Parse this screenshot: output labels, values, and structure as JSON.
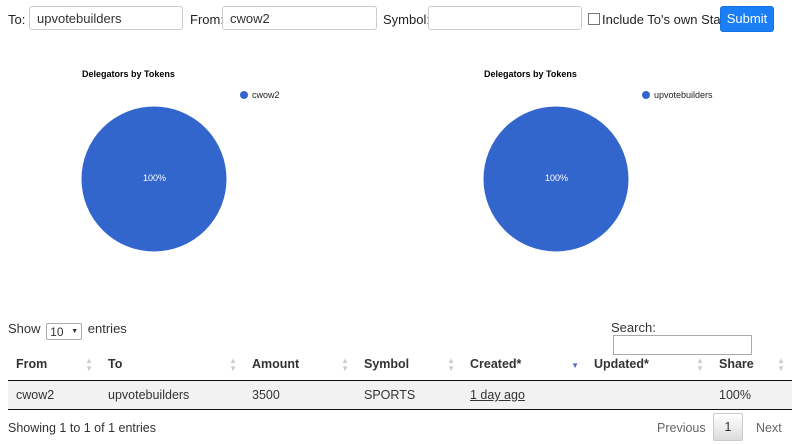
{
  "form": {
    "to_label": "To:",
    "to_value": "upvotebuilders",
    "from_label": "From:",
    "from_value": "cwow2",
    "symbol_label": "Symbol:",
    "symbol_value": "",
    "include_label": "Include To's own Stake",
    "include_checked": false,
    "submit_label": "Submit"
  },
  "charts": [
    {
      "title": "Delegators by Tokens",
      "legend": "cwow2",
      "slice_label": "100%"
    },
    {
      "title": "Delegators by Tokens",
      "legend": "upvotebuilders",
      "slice_label": "100%"
    }
  ],
  "chart_data": [
    {
      "type": "pie",
      "title": "Delegators by Tokens",
      "labels": [
        "cwow2"
      ],
      "values": [
        100
      ],
      "legend": "top-right",
      "colors": [
        "#3366cc"
      ]
    },
    {
      "type": "pie",
      "title": "Delegators by Tokens",
      "labels": [
        "upvotebuilders"
      ],
      "values": [
        100
      ],
      "legend": "top-right",
      "colors": [
        "#3366cc"
      ]
    }
  ],
  "table_controls": {
    "show_label": "Show",
    "entries_value": "10",
    "entries_label": "entries",
    "search_label": "Search:"
  },
  "table": {
    "columns": [
      "From",
      "To",
      "Amount",
      "Symbol",
      "Created*",
      "Updated*",
      "Share"
    ],
    "rows": [
      [
        "cwow2",
        "upvotebuilders",
        "3500",
        "SPORTS",
        "1 day ago",
        "",
        "100%"
      ]
    ]
  },
  "footer": {
    "info": "Showing 1 to 1 of 1 entries",
    "previous": "Previous",
    "page": "1",
    "next": "Next"
  },
  "colors": {
    "accent": "#1a7ef5",
    "pie": "#3366cc"
  }
}
